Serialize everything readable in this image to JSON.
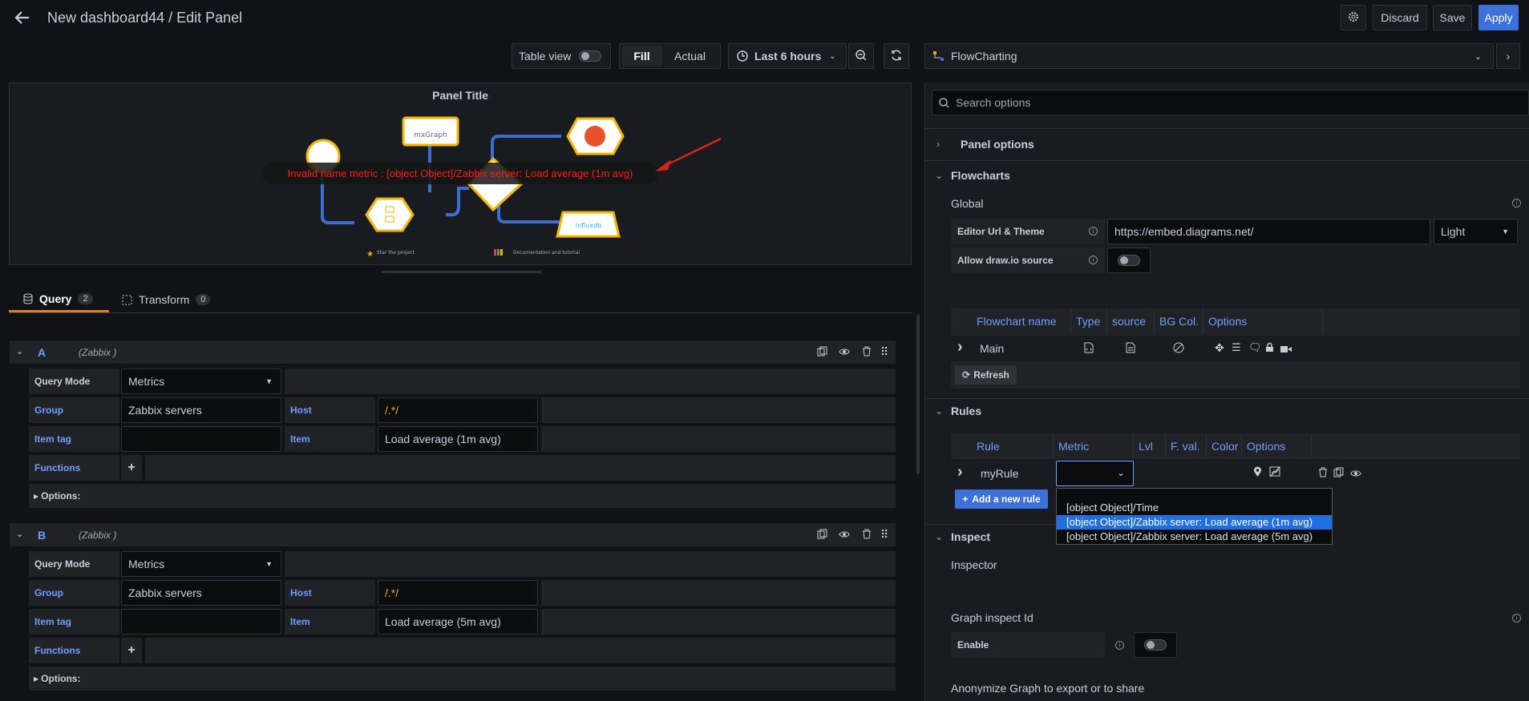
{
  "header": {
    "title": "New dashboard44 / Edit Panel",
    "discard": "Discard",
    "save": "Save",
    "apply": "Apply"
  },
  "toolbar": {
    "table_view": "Table view",
    "fill": "Fill",
    "actual": "Actual",
    "time_range": "Last 6 hours"
  },
  "panel": {
    "title": "Panel Title",
    "error": "Invalid name metric : [object Object]/Zabbix server: Load average (1m avg)",
    "node_mxgraph": "mxGraph",
    "node_influx": "influxdb",
    "star_text": "Star the project",
    "docs_text": "Documentation and tutorial"
  },
  "tabs": {
    "query": "Query",
    "query_count": "2",
    "transform": "Transform",
    "transform_count": "0"
  },
  "queries": [
    {
      "letter": "A",
      "source": "(Zabbix )",
      "query_mode_label": "Query Mode",
      "query_mode": "Metrics",
      "group_label": "Group",
      "group": "Zabbix servers",
      "host_label": "Host",
      "host": "/.*/",
      "item_tag_label": "Item tag",
      "item_tag": "",
      "item_label": "Item",
      "item": "Load average (1m avg)",
      "functions_label": "Functions",
      "options_label": "Options:"
    },
    {
      "letter": "B",
      "source": "(Zabbix )",
      "query_mode_label": "Query Mode",
      "query_mode": "Metrics",
      "group_label": "Group",
      "group": "Zabbix servers",
      "host_label": "Host",
      "host": "/.*/",
      "item_tag_label": "Item tag",
      "item_tag": "",
      "item_label": "Item",
      "item": "Load average (5m avg)",
      "functions_label": "Functions",
      "options_label": "Options:"
    }
  ],
  "options": {
    "plugin": "FlowCharting",
    "search_placeholder": "Search options",
    "panel_options": "Panel options",
    "flowcharts": "Flowcharts",
    "global": "Global",
    "editor_url_label": "Editor Url & Theme",
    "editor_url": "https://embed.diagrams.net/",
    "theme": "Light",
    "allow_drawio": "Allow draw.io source",
    "fc_table_headers": [
      "Flowchart name",
      "Type",
      "source",
      "BG Col.",
      "Options"
    ],
    "fc_row_name": "Main",
    "refresh": "Refresh",
    "rules": "Rules",
    "rules_headers": [
      "Rule",
      "Metric",
      "Lvl",
      "F. val.",
      "Color",
      "Options"
    ],
    "rule_name": "myRule",
    "add_rule": "Add a new rule",
    "metric_options": [
      "[object Object]/Time",
      "[object Object]/Zabbix server: Load average (1m avg)",
      "[object Object]/Zabbix server: Load average (5m avg)"
    ],
    "inspect": "Inspect",
    "inspector": "Inspector",
    "graph_inspect_id": "Graph inspect Id",
    "enable": "Enable",
    "anonymize": "Anonymize Graph to export or to share"
  },
  "colors": {
    "accent": "#3d71d9",
    "error": "#ff0000",
    "link_blue": "#6e9fff",
    "tab_active": "#eb7b18"
  }
}
